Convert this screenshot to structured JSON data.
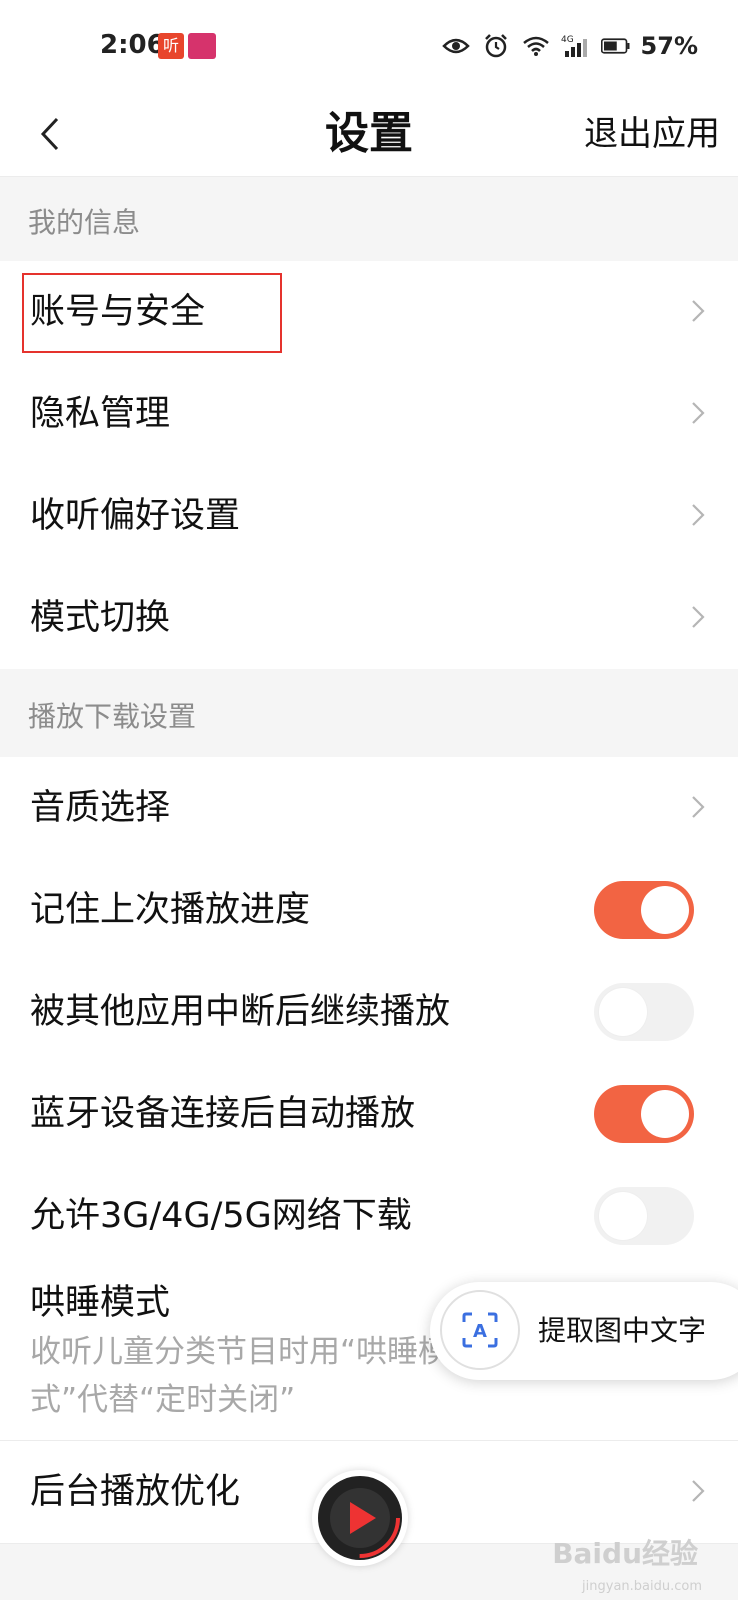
{
  "status_bar": {
    "time": "2:06",
    "app_icon_1": "听",
    "battery": "57%",
    "icons": [
      "eye-icon",
      "alarm-icon",
      "wifi-icon",
      "signal-4g-icon",
      "battery-icon"
    ]
  },
  "header": {
    "title": "设置",
    "right_action": "退出应用",
    "back_icon": "chevron-left-icon"
  },
  "sections": [
    {
      "title": "我的信息",
      "items": [
        {
          "label": "账号与安全",
          "type": "link",
          "highlighted": true
        },
        {
          "label": "隐私管理",
          "type": "link"
        },
        {
          "label": "收听偏好设置",
          "type": "link"
        },
        {
          "label": "模式切换",
          "type": "link"
        }
      ]
    },
    {
      "title": "播放下载设置",
      "items": [
        {
          "label": "音质选择",
          "type": "link"
        },
        {
          "label": "记住上次播放进度",
          "type": "toggle",
          "value": true
        },
        {
          "label": "被其他应用中断后继续播放",
          "type": "toggle",
          "value": false
        },
        {
          "label": "蓝牙设备连接后自动播放",
          "type": "toggle",
          "value": true
        },
        {
          "label": "允许3G/4G/5G网络下载",
          "type": "toggle",
          "value": false
        },
        {
          "label": "哄睡模式",
          "type": "toggle-desc",
          "description": "收听儿童分类节目时用“哄睡模式”代替“定时关闭”"
        },
        {
          "label": "后台播放优化",
          "type": "link"
        }
      ]
    }
  ],
  "ocr_popup": {
    "label": "提取图中文字",
    "icon": "text-recognition-icon"
  },
  "watermark": {
    "text": "Baidu经验",
    "sub": "jingyan.baidu.com"
  },
  "colors": {
    "accent": "#f26443",
    "highlight_box": "#e5322d",
    "section_bg": "#f5f5f5"
  }
}
